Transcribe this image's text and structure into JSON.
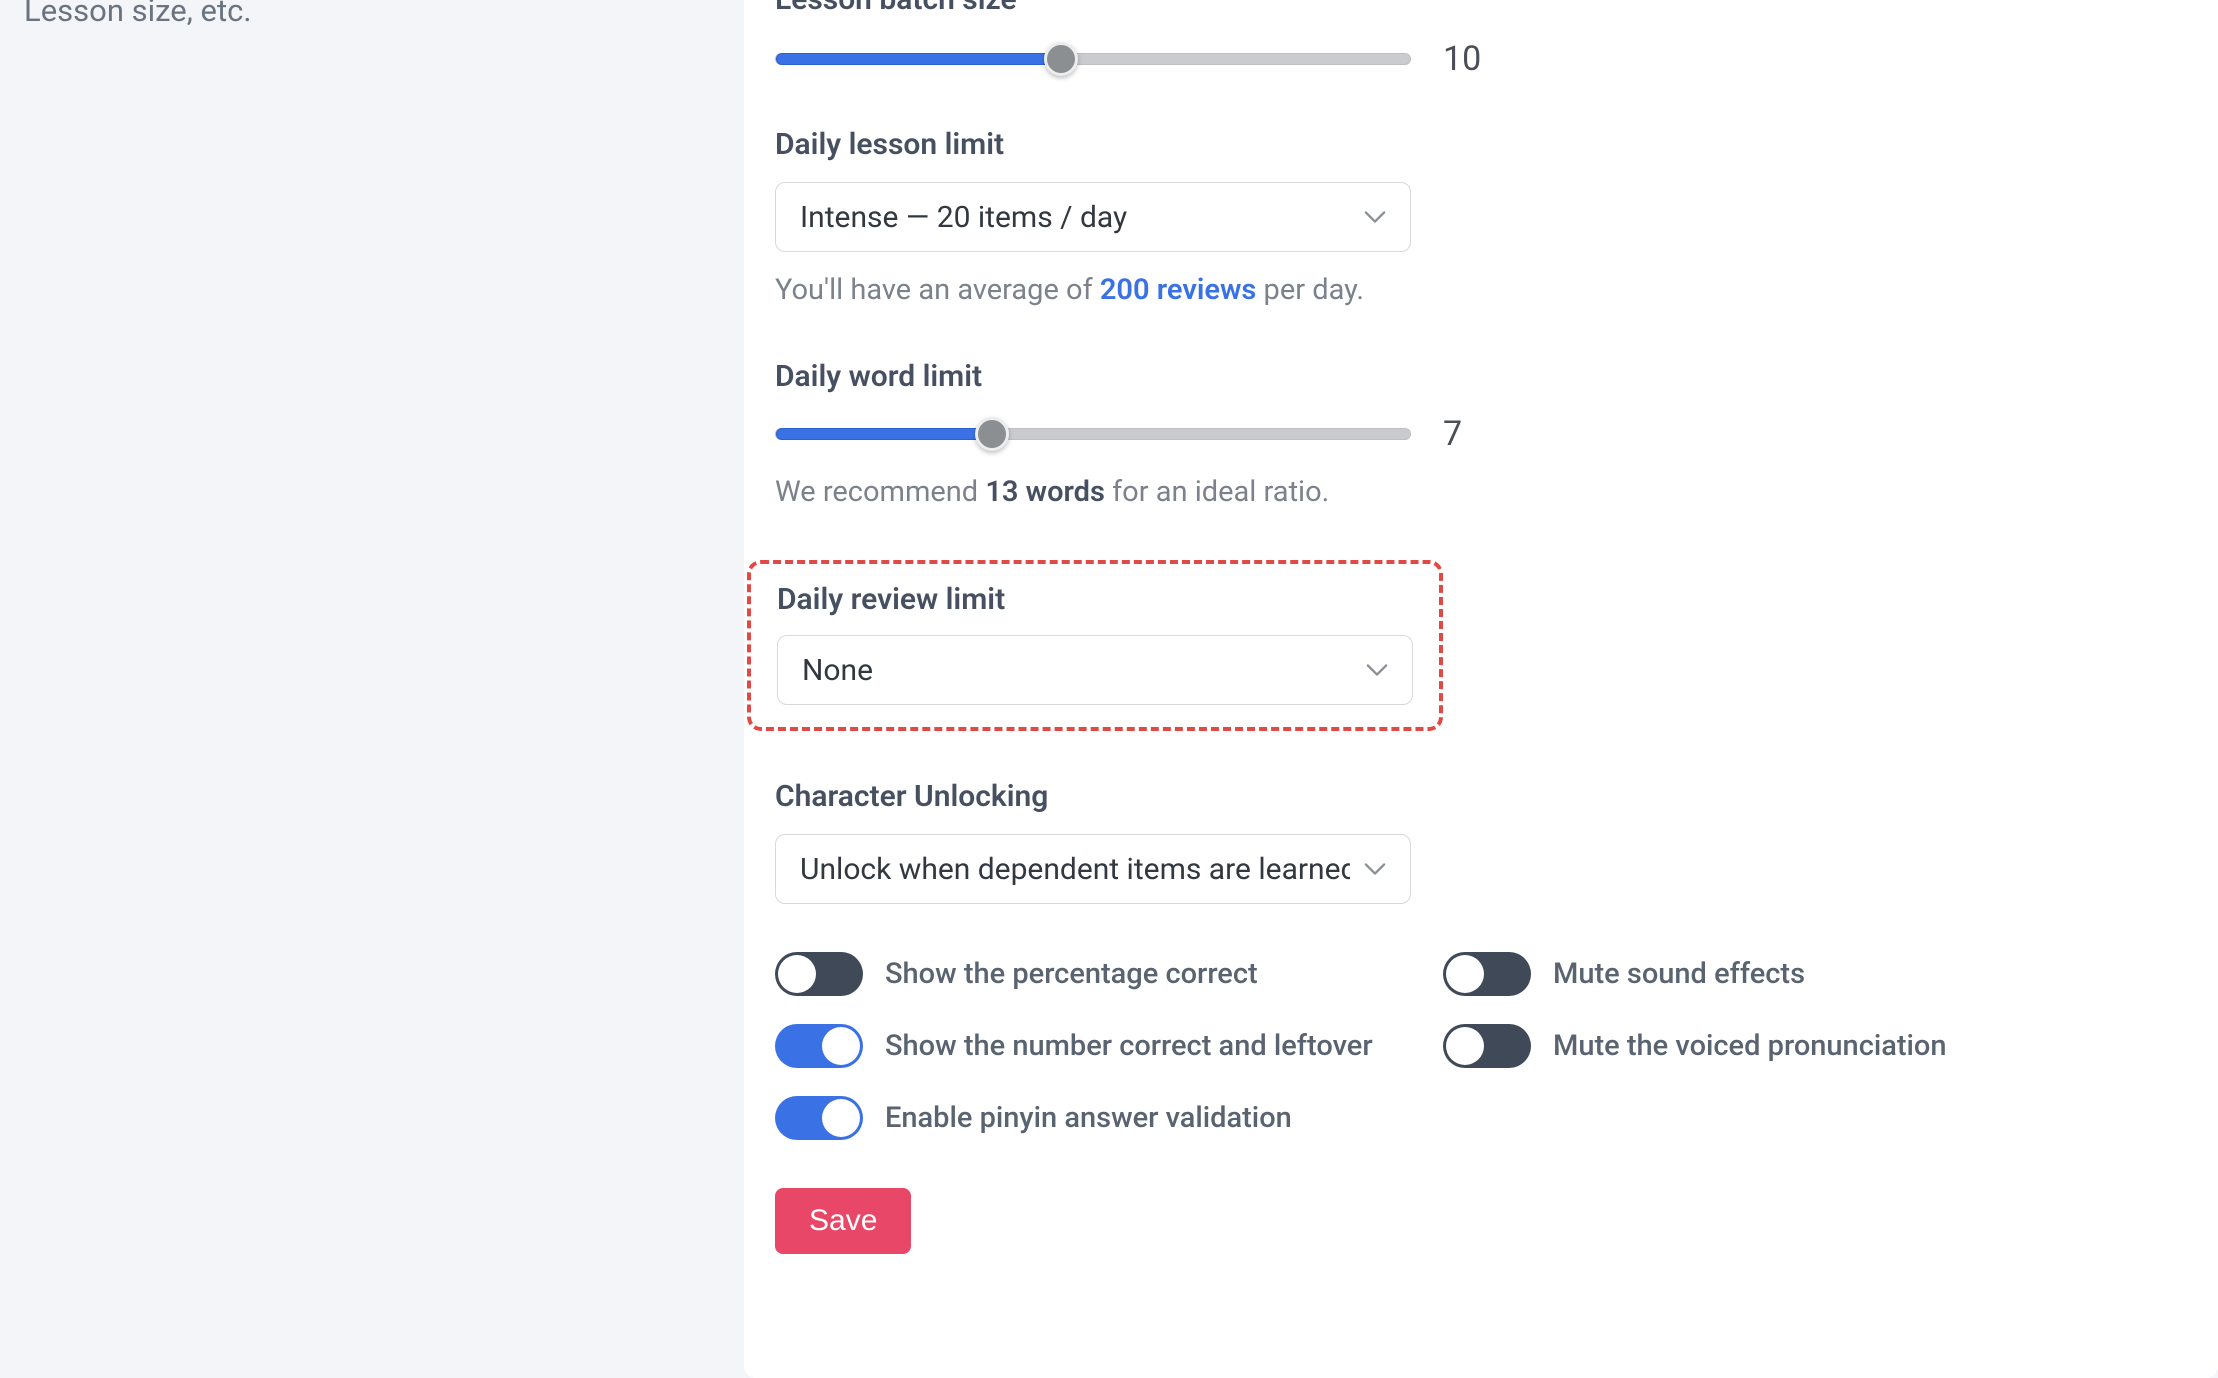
{
  "sidebar": {
    "partial_text": "Lesson size, etc."
  },
  "lesson_batch": {
    "label": "Lesson batch size",
    "value": "10",
    "fill_pct": 45
  },
  "daily_lesson": {
    "label": "Daily lesson limit",
    "selected": "Intense — 20 items / day",
    "helper_prefix": "You'll have an average of ",
    "helper_link": "200 reviews",
    "helper_suffix": " per day."
  },
  "daily_word": {
    "label": "Daily word limit",
    "value": "7",
    "fill_pct": 34,
    "helper_prefix": "We recommend ",
    "helper_bold": "13 words",
    "helper_suffix": " for an ideal ratio."
  },
  "daily_review": {
    "label": "Daily review limit",
    "selected": "None"
  },
  "char_unlock": {
    "label": "Character Unlocking",
    "selected": "Unlock when dependent items are learned"
  },
  "toggles": {
    "show_pct_correct": {
      "label": "Show the percentage correct",
      "on": false
    },
    "mute_sound": {
      "label": "Mute sound effects",
      "on": false
    },
    "show_num_correct": {
      "label": "Show the number correct and leftover",
      "on": true
    },
    "mute_voice": {
      "label": "Mute the voiced pronunciation",
      "on": false
    },
    "pinyin_validation": {
      "label": "Enable pinyin answer validation",
      "on": true
    }
  },
  "save_label": "Save"
}
